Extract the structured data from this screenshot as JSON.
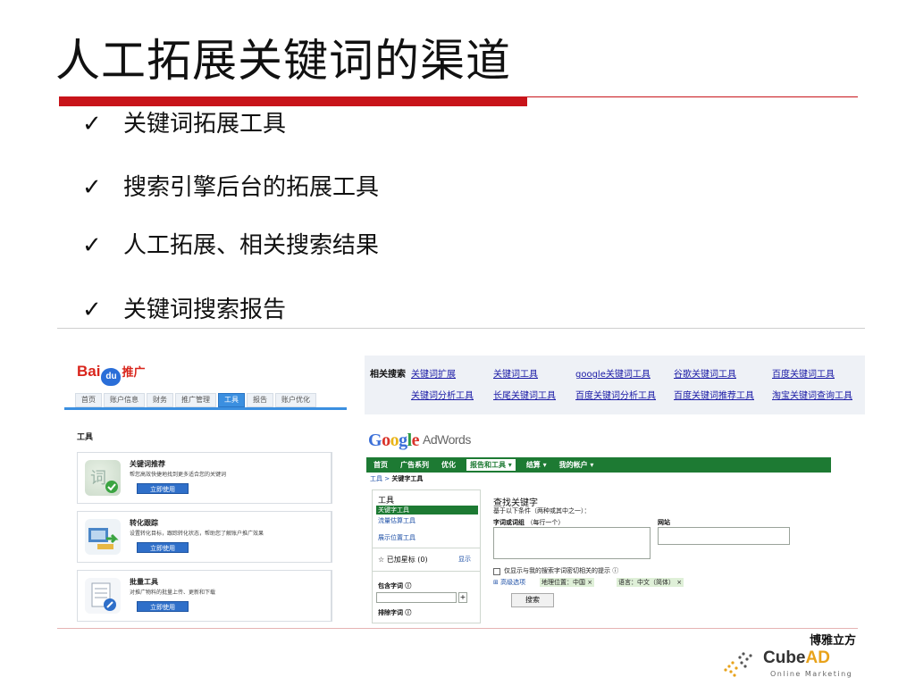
{
  "slide": {
    "title": "人工拓展关键词的渠道",
    "bullets": [
      {
        "mark": "✓",
        "text": "关键词拓展工具"
      },
      {
        "mark": "✓",
        "text": "搜索引擎后台的拓展工具"
      },
      {
        "mark": "✓",
        "text": "人工拓展、相关搜索结果"
      },
      {
        "mark": "✓",
        "text": "关键词搜索报告"
      }
    ],
    "accent_color": "#c8141a"
  },
  "baidu": {
    "logo_text": "Bai",
    "logo_paw": "du",
    "logo_suffix": "推广",
    "nav": [
      "首页",
      "账户信息",
      "财务",
      "推广管理",
      "工具",
      "报告",
      "账户优化"
    ],
    "active_nav": "工具",
    "section_title": "工具",
    "cards": [
      {
        "title": "关键词推荐",
        "desc": "帮您高效快捷地找到更多适合您的关键词",
        "button": "立即使用",
        "icon": "keyword-recommend-icon"
      },
      {
        "title": "转化跟踪",
        "desc": "设置转化目标，跟踪转化状态，帮助您了解账户推广效果",
        "button": "立即使用",
        "icon": "conversion-tracking-icon"
      },
      {
        "title": "批量工具",
        "desc": "对推广物料的批量上传、更新和下载",
        "button": "立即使用",
        "icon": "batch-tool-icon"
      }
    ]
  },
  "related": {
    "label": "相关搜索",
    "row1": [
      "关键词扩展",
      "关键词工具",
      "google关键词工具",
      "谷歌关键词工具",
      "百度关键词工具"
    ],
    "row2": [
      "关键词分析工具",
      "长尾关键词工具",
      "百度关键词分析工具",
      "百度关键词推荐工具",
      "淘宝关键词查询工具"
    ]
  },
  "adwords": {
    "logo": "Google",
    "product": "AdWords",
    "nav": [
      "首页",
      "广告系列",
      "优化",
      "报告和工具 ▾",
      "结算 ▾",
      "我的帐户 ▾"
    ],
    "active_nav": "报告和工具 ▾",
    "breadcrumb_link": "工具",
    "breadcrumb_sep": " > ",
    "breadcrumb_current": "关键字工具",
    "sidebar": {
      "heading": "工具",
      "selected": "关键字工具",
      "links": [
        "流量估算工具",
        "展示位置工具"
      ],
      "starred": "☆ 已加星标 (0)",
      "show": "显示",
      "include_label": "包含字词 ⓘ",
      "exclude_label": "排除字词 ⓘ"
    },
    "main": {
      "title": "查找关键字",
      "subtitle": "基于以下条件（两种或其中之一）：",
      "words_label": "字词或词组",
      "words_hint": "（每行一个）",
      "site_label": "网站",
      "only_closely": "仅显示与我的搜索字词密切相关的提示 ⓘ",
      "advanced": "⊞ 高级选项",
      "filter_location": "地理位置：中国 ×",
      "filter_language": "语言：中文（简体） ×",
      "search_button": "搜索"
    },
    "brand_color": "#1d7a33"
  },
  "footer_logo": {
    "cn": "博雅立方",
    "en": "CubeAD",
    "tagline": "Online Marketing"
  }
}
